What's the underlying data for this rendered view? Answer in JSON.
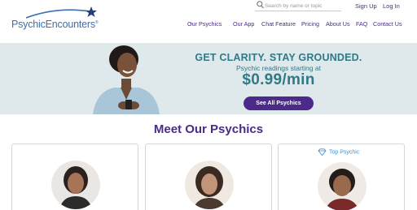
{
  "brand": {
    "name_part1": "Psychic",
    "name_part2": "Encounters",
    "reg": "®"
  },
  "search": {
    "placeholder": "Search by name or topic"
  },
  "auth": {
    "signup": "Sign Up",
    "login": "Log In"
  },
  "nav": {
    "items": [
      {
        "label": "Our Psychics",
        "has_dropdown": true
      },
      {
        "label": "Our App"
      },
      {
        "label": "Chat Feature"
      },
      {
        "label": "Pricing"
      },
      {
        "label": "About Us"
      },
      {
        "label": "FAQ"
      },
      {
        "label": "Contact Us"
      }
    ]
  },
  "hero": {
    "headline": "GET CLARITY. STAY GROUNDED.",
    "subhead": "Psychic readings starting at",
    "price": "$0.99/min",
    "cta": "See All Psychics"
  },
  "section": {
    "title": "Meet Our Psychics"
  },
  "cards": [
    {
      "badge": ""
    },
    {
      "badge": ""
    },
    {
      "badge": "Top Psychic"
    }
  ],
  "colors": {
    "brand_purple": "#4b2a8a",
    "teal": "#2f7a86",
    "logo_blue": "#3a6fb0",
    "hero_bg": "#dfe8ea"
  }
}
